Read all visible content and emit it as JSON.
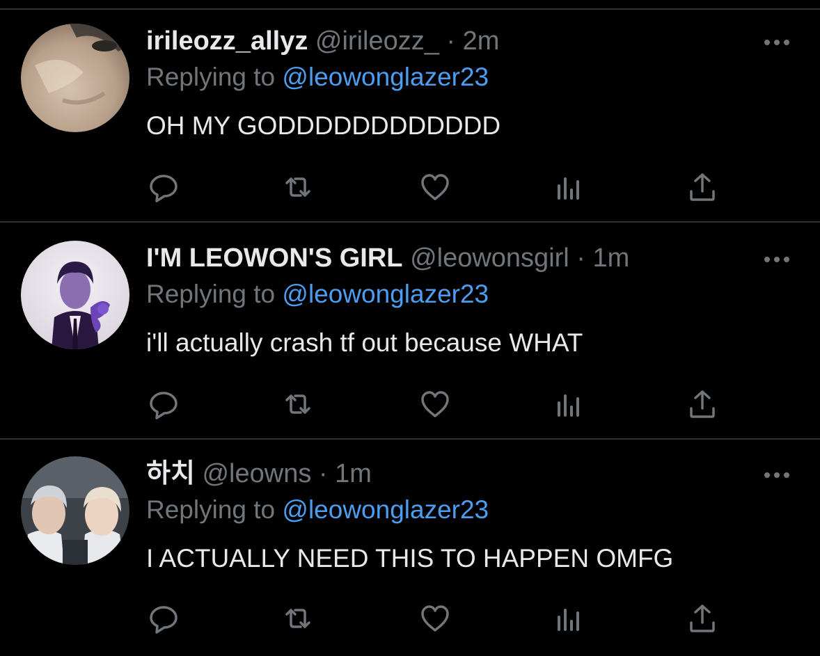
{
  "colors": {
    "background": "#000000",
    "divider": "#2f3336",
    "primary_text": "#e7e9ea",
    "secondary_text": "#71767b",
    "link": "#4b9ef1"
  },
  "action_icons": [
    "reply-icon",
    "retweet-icon",
    "like-icon",
    "views-icon",
    "share-icon"
  ],
  "tweets": [
    {
      "display_name": "irileozz_allyz",
      "handle": "@irileozz_",
      "separator": "·",
      "time": "2m",
      "replying_prefix": "Replying to",
      "replying_to": "@leowonglazer23",
      "text": "OH MY GODDDDDDDDDDDD"
    },
    {
      "display_name": "I'M LEOWON'S GIRL",
      "handle": "@leowonsgirl",
      "separator": "·",
      "time": "1m",
      "replying_prefix": "Replying to",
      "replying_to": "@leowonglazer23",
      "text": "i'll actually crash tf out because WHAT"
    },
    {
      "display_name": "하치",
      "handle": "@leowns",
      "separator": "·",
      "time": "1m",
      "replying_prefix": "Replying to",
      "replying_to": "@leowonglazer23",
      "text": "I ACTUALLY NEED THIS TO HAPPEN OMFG"
    }
  ]
}
